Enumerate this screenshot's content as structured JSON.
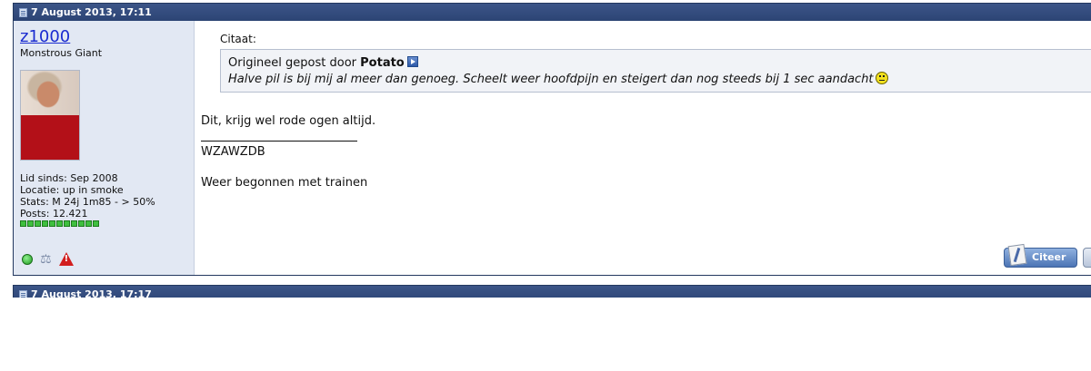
{
  "post": {
    "date": "7 August 2013, 17:11",
    "user": {
      "name": "z1000",
      "title": "Monstrous Giant",
      "member_since": "Lid sinds: Sep 2008",
      "location": "Locatie: up in smoke",
      "stats": "Stats: M 24j 1m85 - > 50%",
      "posts": "Posts: 12.421",
      "post_bar_segments": 11
    },
    "quote": {
      "label": "Citaat:",
      "prefix": "Origineel gepost door",
      "author": "Potato",
      "text": "Halve pil is bij mij al meer dan genoeg. Scheelt weer hoofdpijn en steigert dan nog steeds bij 1 sec aandacht"
    },
    "message": "Dit, krijg wel rode ogen altijd.",
    "signature": [
      "WZAWZDB",
      "Weer begonnen met trainen"
    ],
    "quote_button_label": "Citeer"
  },
  "next_post": {
    "date": "7 August 2013, 17:17"
  },
  "colors": {
    "header": "#2c4474",
    "user_panel": "#e2e8f3",
    "username": "#1a2bd0"
  }
}
